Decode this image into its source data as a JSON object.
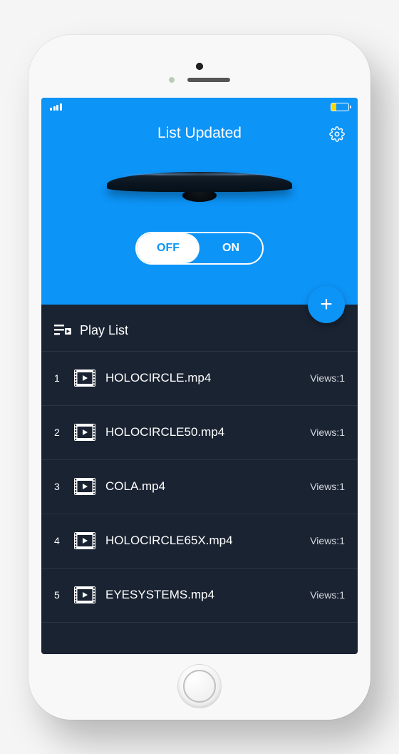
{
  "header": {
    "title": "List Updated",
    "toggle_off": "OFF",
    "toggle_on": "ON"
  },
  "playlist": {
    "header": "Play List",
    "views_prefix": "Views:",
    "items": [
      {
        "index": "1",
        "name": "HOLOCIRCLE.mp4",
        "views": "1"
      },
      {
        "index": "2",
        "name": "HOLOCIRCLE50.mp4",
        "views": "1"
      },
      {
        "index": "3",
        "name": "COLA.mp4",
        "views": "1"
      },
      {
        "index": "4",
        "name": "HOLOCIRCLE65X.mp4",
        "views": "1"
      },
      {
        "index": "5",
        "name": "EYESYSTEMS.mp4",
        "views": "1"
      }
    ]
  }
}
